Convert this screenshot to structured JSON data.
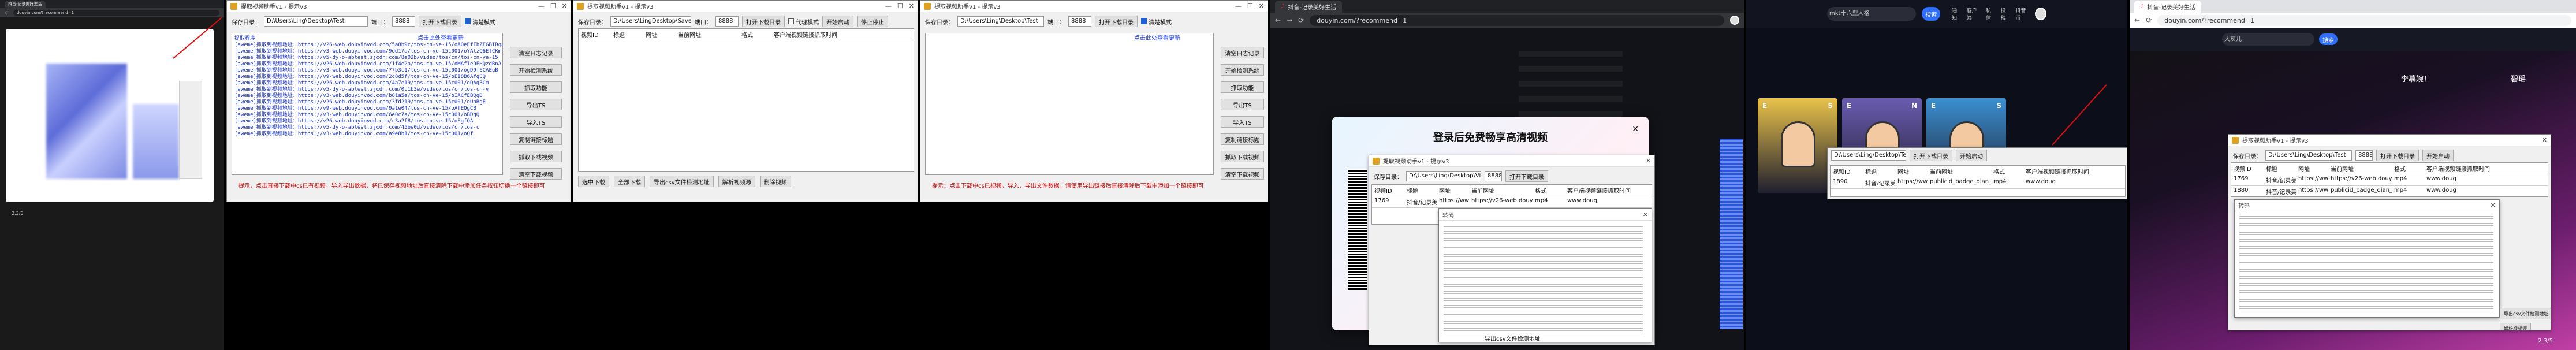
{
  "app": {
    "title": "提取视频助手v1 - 提示v3",
    "path_label": "保存目录：",
    "path_value": "D:\\Users\\Ling\\Desktop\\Test",
    "path_value_alt": "D:\\Users\\Ling\\Desktop\\Vid",
    "path_value_short": "D:\\Users\\LingDesktop\\Save",
    "port_label": "端口：",
    "port_value": "8888",
    "open_dir_btn": "打开下载目录",
    "clean_mode_label": "清楚模式",
    "proxy_mode_label": "代理模式",
    "start_btn": "开始启动",
    "stop_btn": "停止停止",
    "cols": [
      "视频ID",
      "标题",
      "网址",
      "当前网址",
      "格式",
      "客户端视频链接",
      "抓取时间"
    ],
    "side_buttons": [
      "清空日志记录",
      "开始检测系统",
      "抓取功能",
      "导出TS",
      "导入TS"
    ],
    "side_buttons_b": [
      "复制链接标题",
      "抓取下载视频",
      "清空下载视频"
    ],
    "update_link": "点击此处查看更新",
    "bottom_btns": [
      "选中下载",
      "全部下载",
      "导出csv文件检测地址",
      "解析视频源",
      "删除视频"
    ],
    "tip": "提示，点击直接下载中cs已有视频，导入导出数据，将已保存视频地址后直接清除下载中添加任务按钮切换一个链接即可",
    "tip_short": "提示：点击下载中cs已视频，导入，导出文件数据，请使用导出链接后直接清除后下载中添加一个链接即可",
    "log_lines": [
      "提取程序",
      "[aweme]抓取到视频地址：https://v26-web.douyinvod.com/5a8b9c/tos-cn-ve-15/oAQeEfIbZFGBIDqABCgNnf",
      "[aweme]抓取到视频地址：https://v3-web.douyinvod.com/9dd17a/tos-cn-ve-15c001/oYAlzQ6EfCKmIAb",
      "[aweme]抓取到视频地址：https://v5-dy-o-abtest.zjcdn.com/8e02b/video/tos/cn/tos-cn-ve-15",
      "[aweme]抓取到视频地址：https://v26-web.douyinvod.com/1f4e2a/tos-cn-ve-15/oMAfIeDEHQzgBnA",
      "[aweme]抓取到视频地址：https://v3-web.douyinvod.com/77b3c1/tos-cn-ve-15c001/ogD9fECAEuB",
      "[aweme]抓取到视频地址：https://v9-web.douyinvod.com/2c8d5f/tos-cn-ve-15/oEI8B6AfgCQ",
      "[aweme]抓取到视频地址：https://v26-web.douyinvod.com/4a7e19/tos-cn-ve-15c001/oQAgBCm",
      "[aweme]抓取到视频地址：https://v5-dy-o-abtest.zjcdn.com/0c1b3e/video/tos/cn/tos-cn-v",
      "[aweme]抓取到视频地址：https://v3-web.douyinvod.com/b81a5e/tos-cn-ve-15/oIACfEBQgD",
      "[aweme]抓取到视频地址：https://v26-web.douyinvod.com/3fd219/tos-cn-ve-15c001/oUnBgE",
      "[aweme]抓取到视频地址：https://v9-web.douyinvod.com/9a1e04/tos-cn-ve-15/oAfEQgCB",
      "[aweme]抓取到视频地址：https://v3-web.douyinvod.com/6e0c7a/tos-cn-ve-15c001/oBDgQ",
      "[aweme]抓取到视频地址：https://v26-web.douyinvod.com/c3a2f8/tos-cn-ve-15/oEgfQA",
      "[aweme]抓取到视频地址：https://v5-dy-o-abtest.zjcdn.com/45be0d/video/tos/cn/tos-c",
      "[aweme]抓取到视频地址：https://v3-web.douyinvod.com/a9e8b1/tos-cn-ve-15c001/oQf"
    ]
  },
  "browser": {
    "url_douyin": "douyin.com/?recommend=1",
    "url_douyin2": "douyin.com/?recommend=1",
    "url_douyin3": "douyin.com/?recommend=1",
    "tab_label": "抖音-记录美好生活",
    "search_placeholder": "mkt十六型人格",
    "search_btn": "搜索",
    "search_query2": "大灰儿",
    "top_icons": [
      "通知",
      "客户端",
      "私信",
      "投稿",
      "抖音币"
    ],
    "login_btn": "主播",
    "login_modal_title": "登录后免费畅享高清视频",
    "modal_close": "✕",
    "right_title": "李慕婉！",
    "right_title2": "碧瑶",
    "cards": [
      "E",
      "S",
      "E",
      "N",
      "E",
      "S"
    ],
    "taskbar_label": "导出csv文件检测地址",
    "counter": "2.3/5"
  },
  "detail": {
    "title": "转码",
    "row": [
      "1769",
      "抖音/记录美",
      "https://www.d",
      "https://v26-web.douyinvod.com",
      "mp4",
      "www.doug"
    ],
    "row_b": [
      "1890",
      "抖音/记录美",
      "https://www.d",
      "publicid_badge_dian_pub_a:3.1",
      "mp4",
      "www.doug"
    ],
    "row_c": [
      "1880",
      "抖音/记录美",
      "https://www.d",
      "publicid_badge_dian_pub/1612",
      "mp4",
      "www.doug"
    ]
  },
  "colors": {
    "red": "#e01010",
    "blue": "#1530d8",
    "douyin_pink": "#fe2c55",
    "search_blue": "#2f6fff"
  }
}
